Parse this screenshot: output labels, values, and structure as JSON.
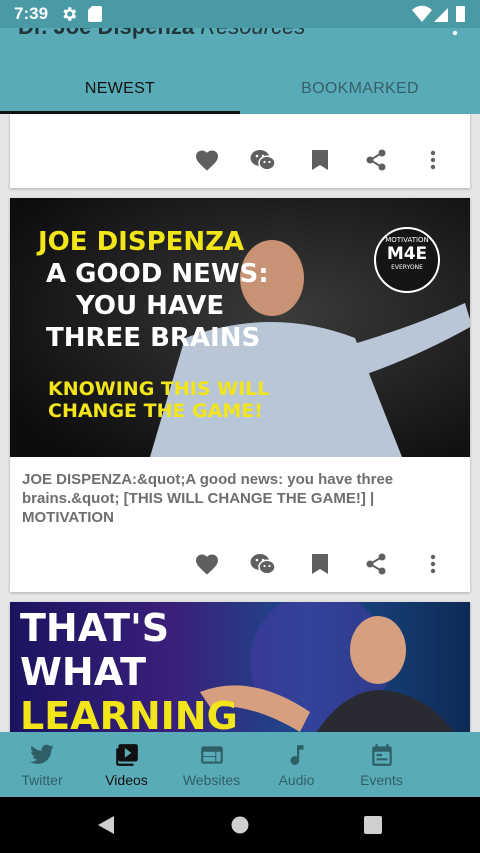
{
  "status": {
    "time": "7:39"
  },
  "app": {
    "title_bold": "Dr. Joe Dispenza",
    "title_italic": " Resources"
  },
  "tabs": [
    {
      "label": "NEWEST"
    },
    {
      "label": "BOOKMARKED"
    }
  ],
  "videos": [
    {
      "thumbnail_lines": [
        "JOE DISPENZA",
        "A GOOD NEWS:",
        "YOU HAVE",
        "THREE BRAINS",
        "KNOWING THIS WILL",
        "CHANGE THE GAME!"
      ],
      "badge": [
        "MOTIVATION",
        "M4E",
        "EVERYONE"
      ],
      "title": "JOE DISPENZA:&quot;A good news: you have three brains.&quot; [THIS WILL CHANGE THE GAME!] | MOTIVATION"
    },
    {
      "thumbnail_lines": [
        "THAT'S",
        "WHAT",
        "LEARNING"
      ]
    }
  ],
  "bottom_nav": [
    {
      "label": "Twitter",
      "icon": "twitter-icon"
    },
    {
      "label": "Videos",
      "icon": "video-library-icon"
    },
    {
      "label": "Websites",
      "icon": "web-icon"
    },
    {
      "label": "Audio",
      "icon": "music-note-icon"
    },
    {
      "label": "Events",
      "icon": "calendar-icon"
    }
  ],
  "colors": {
    "primary": "#5aabb8",
    "status_bar": "#4a9aa6",
    "nav_inactive": "#2f5f66",
    "thumb_yellow": "#f2e51a"
  }
}
